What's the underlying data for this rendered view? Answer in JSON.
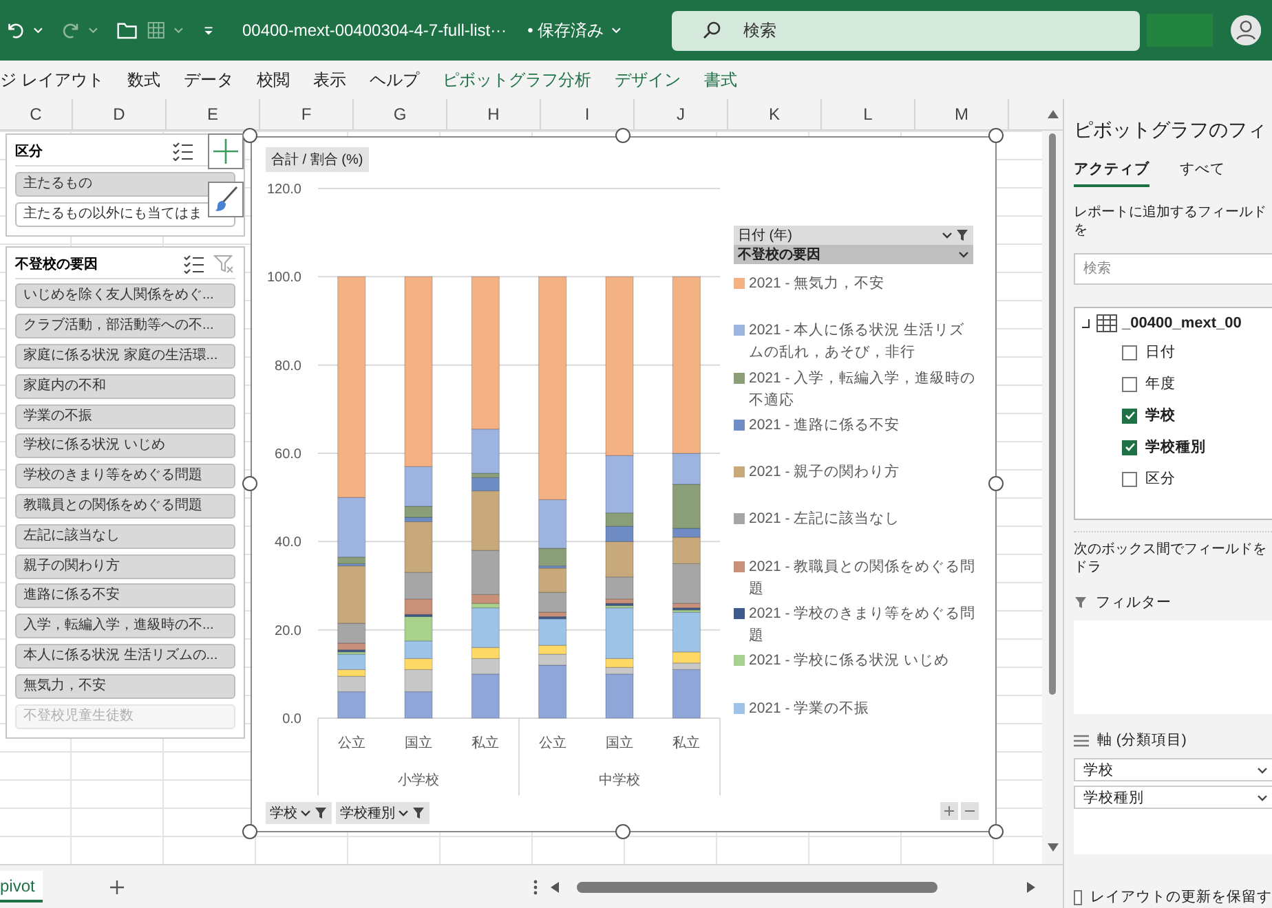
{
  "title_bar": {
    "file_name": "00400-mext-00400304-4-7-full-list···",
    "save_status": "• 保存済み",
    "search": {
      "placeholder": "検索"
    }
  },
  "ribbon": {
    "tabs": [
      {
        "label": "ジ レイアウト",
        "contextual": false
      },
      {
        "label": "数式",
        "contextual": false
      },
      {
        "label": "データ",
        "contextual": false
      },
      {
        "label": "校閲",
        "contextual": false
      },
      {
        "label": "表示",
        "contextual": false
      },
      {
        "label": "ヘルプ",
        "contextual": false
      },
      {
        "label": "ピボットグラフ分析",
        "contextual": true
      },
      {
        "label": "デザイン",
        "contextual": true
      },
      {
        "label": "書式",
        "contextual": true
      }
    ]
  },
  "column_headers": [
    "C",
    "D",
    "E",
    "F",
    "G",
    "H",
    "I",
    "J",
    "K",
    "L",
    "M"
  ],
  "slicers": [
    {
      "title": "区分",
      "show_clear_filter": false,
      "items": [
        {
          "label": "主たるもの",
          "selected": true,
          "disabled": false
        },
        {
          "label": "主たるもの以外にも当てはま",
          "selected": false,
          "disabled": false
        }
      ]
    },
    {
      "title": "不登校の要因",
      "show_clear_filter": true,
      "items": [
        {
          "label": "いじめを除く友人関係をめぐ...",
          "selected": true,
          "disabled": false
        },
        {
          "label": "クラブ活動，部活動等への不...",
          "selected": true,
          "disabled": false
        },
        {
          "label": "家庭に係る状況 家庭の生活環...",
          "selected": true,
          "disabled": false
        },
        {
          "label": "家庭内の不和",
          "selected": true,
          "disabled": false
        },
        {
          "label": "学業の不振",
          "selected": true,
          "disabled": false
        },
        {
          "label": "学校に係る状況 いじめ",
          "selected": true,
          "disabled": false
        },
        {
          "label": "学校のきまり等をめぐる問題",
          "selected": true,
          "disabled": false
        },
        {
          "label": "教職員との関係をめぐる問題",
          "selected": true,
          "disabled": false
        },
        {
          "label": "左記に該当なし",
          "selected": true,
          "disabled": false
        },
        {
          "label": "親子の関わり方",
          "selected": true,
          "disabled": false
        },
        {
          "label": "進路に係る不安",
          "selected": true,
          "disabled": false
        },
        {
          "label": "入学，転編入学，進級時の不...",
          "selected": true,
          "disabled": false
        },
        {
          "label": "本人に係る状況 生活リズムの...",
          "selected": true,
          "disabled": false
        },
        {
          "label": "無気力，不安",
          "selected": true,
          "disabled": false
        },
        {
          "label": "不登校児童生徒数",
          "selected": false,
          "disabled": true
        }
      ]
    }
  ],
  "chart": {
    "value_field_button": "合計 / 割合 (%)",
    "legend_field_buttons": [
      {
        "label": "日付 (年)",
        "filter": true
      },
      {
        "label": "不登校の要因",
        "filter": false
      }
    ],
    "axis_field_buttons": [
      {
        "label": "学校",
        "filter": true
      },
      {
        "label": "学校種別",
        "filter": true
      }
    ],
    "category_groups": [
      "小学校",
      "中学校"
    ],
    "chart_data": {
      "type": "bar",
      "stacked": true,
      "orientation": "vertical",
      "grid": true,
      "legend": true,
      "categories": [
        "公立",
        "国立",
        "私立",
        "公立",
        "国立",
        "私立"
      ],
      "ylim": [
        0,
        120
      ],
      "yticks": [
        {
          "value": 0,
          "label": "0.0"
        },
        {
          "value": 20,
          "label": "20.0"
        },
        {
          "value": 40,
          "label": "40.0"
        },
        {
          "value": 60,
          "label": "60.0"
        },
        {
          "value": 80,
          "label": "80.0"
        },
        {
          "value": 100,
          "label": "100.0"
        },
        {
          "value": 120,
          "label": "120.0"
        }
      ],
      "series": [
        {
          "name": "2021 - 無気力，不安",
          "color": "#f4b183",
          "values": [
            50,
            43,
            34.5,
            50.5,
            40.5,
            40
          ]
        },
        {
          "name": "2021 - 本人に係る状況 生活リズムの乱れ，あそび，非行",
          "color": "#9db3e0",
          "values": [
            13.5,
            9,
            10,
            11,
            13,
            7
          ]
        },
        {
          "name": "2021 - 入学，転編入学，進級時の不適応",
          "color": "#8a9f78",
          "values": [
            1.5,
            2.5,
            1,
            4,
            3,
            10
          ]
        },
        {
          "name": "2021 - 進路に係る不安",
          "color": "#6f8cc4",
          "values": [
            0.5,
            1,
            3,
            0.5,
            3.5,
            2
          ]
        },
        {
          "name": "2021 - 親子の関わり方",
          "color": "#c7a97c",
          "values": [
            13,
            11.5,
            13.5,
            5.5,
            8,
            6
          ]
        },
        {
          "name": "2021 - 左記に該当なし",
          "color": "#a6a6a6",
          "values": [
            4.5,
            6,
            10,
            4.5,
            5,
            9
          ]
        },
        {
          "name": "2021 - 教職員との関係をめぐる問題",
          "color": "#c9917a",
          "values": [
            1.5,
            3.5,
            2,
            1,
            1,
            1
          ]
        },
        {
          "name": "2021 - 学校のきまり等をめぐる問題",
          "color": "#3d5a8a",
          "values": [
            0.5,
            0.5,
            0,
            0.5,
            0.5,
            0.5
          ]
        },
        {
          "name": "2021 - 学校に係る状況 いじめ",
          "color": "#a9d18e",
          "values": [
            0.5,
            5.5,
            1,
            0,
            0.5,
            0.5
          ]
        },
        {
          "name": "2021 - 学業の不振",
          "color": "#9dc3e6",
          "values": [
            3.5,
            4,
            9,
            6,
            11.5,
            9
          ]
        },
        {
          "color": "#ffd966",
          "values": [
            1.5,
            2.5,
            2.5,
            2,
            2,
            2.5
          ]
        },
        {
          "color": "#c8c8c8",
          "values": [
            3.5,
            5,
            3.5,
            2.5,
            1.5,
            1.5
          ]
        },
        {
          "color": "#8ea6d8",
          "values": [
            6,
            6,
            10,
            12,
            10,
            11
          ]
        }
      ]
    }
  },
  "field_pane": {
    "title": "ピボットグラフのフィ",
    "tabs": [
      {
        "label": "アクティブ",
        "selected": true
      },
      {
        "label": "すべて",
        "selected": false
      }
    ],
    "instruction": "レポートに追加するフィールドを",
    "search": {
      "placeholder": "検索"
    },
    "table": {
      "label": "_00400_mext_00",
      "children": [
        {
          "label": "日付",
          "checked": false
        },
        {
          "label": "年度",
          "checked": false
        },
        {
          "label": "学校",
          "checked": true
        },
        {
          "label": "学校種別",
          "checked": true
        },
        {
          "label": "区分",
          "checked": false
        }
      ]
    },
    "areas_instruction": "次のボックス間でフィールドをドラ",
    "filters": {
      "label": "フィルター"
    },
    "axis": {
      "label": "軸 (分類項目)",
      "fields": [
        "学校",
        "学校種別"
      ]
    },
    "defer_update": {
      "label": "レイアウトの更新を保留す",
      "checked": false
    }
  },
  "sheet_tabs": [
    {
      "label": "pivot",
      "selected": true
    }
  ]
}
